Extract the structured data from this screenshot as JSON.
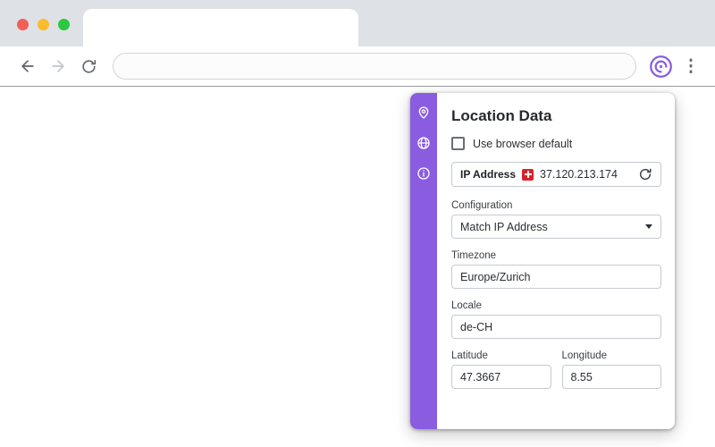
{
  "browser": {
    "address_bar": {
      "value": "",
      "placeholder": ""
    },
    "menu_dots": "⋮"
  },
  "panel": {
    "title": "Location Data",
    "use_browser_default": {
      "label": "Use browser default",
      "checked": false
    },
    "ip_address": {
      "label": "IP Address",
      "value": "37.120.213.174",
      "country_flag": "CH"
    },
    "fields": {
      "configuration": {
        "label": "Configuration",
        "value": "Match IP Address"
      },
      "timezone": {
        "label": "Timezone",
        "value": "Europe/Zurich"
      },
      "locale": {
        "label": "Locale",
        "value": "de-CH"
      },
      "latitude": {
        "label": "Latitude",
        "value": "47.3667"
      },
      "longitude": {
        "label": "Longitude",
        "value": "8.55"
      }
    },
    "sidebar_icons": [
      "location-pin",
      "globe",
      "info"
    ]
  },
  "colors": {
    "accent_purple": "#8a5ce0",
    "flag_red": "#d8232a"
  }
}
